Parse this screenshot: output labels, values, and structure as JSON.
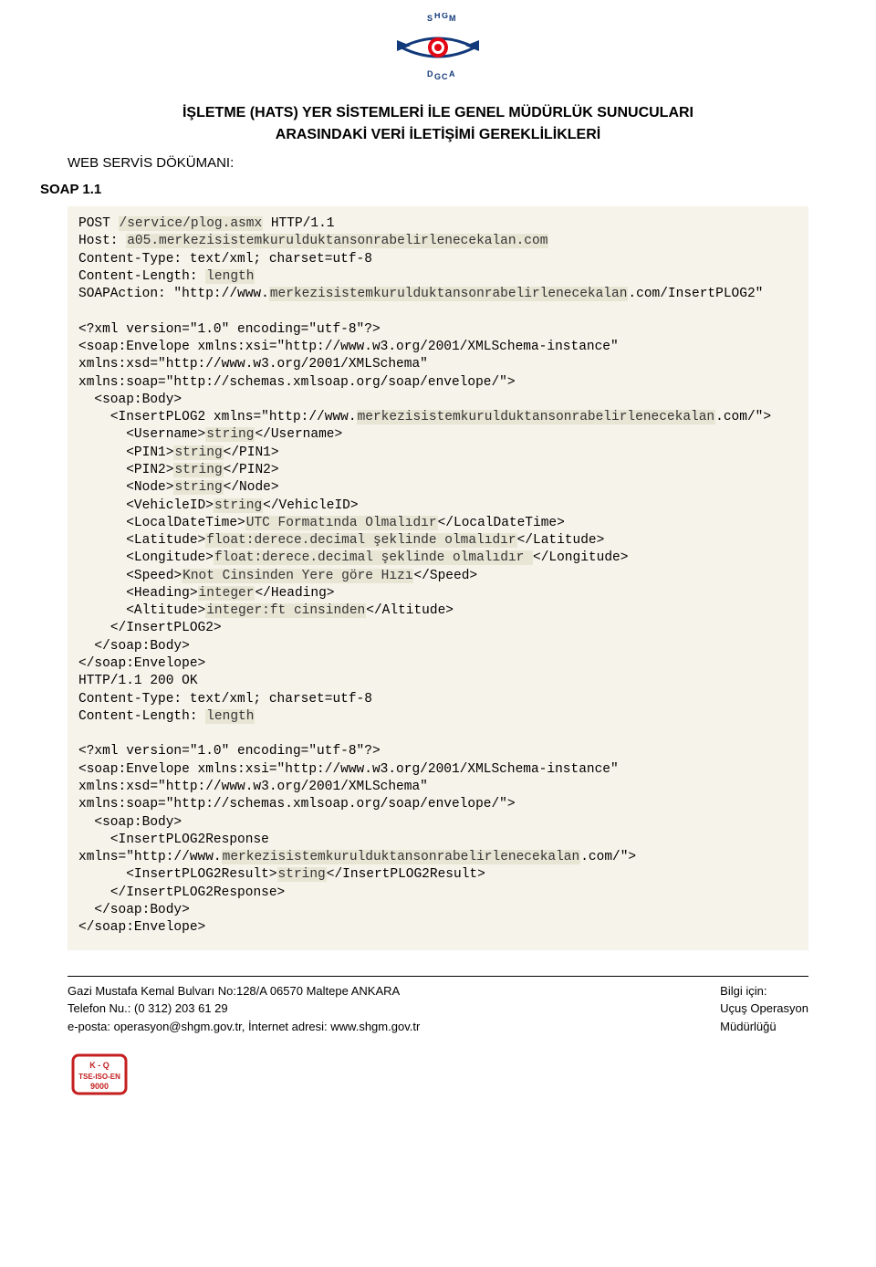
{
  "logo_text_top": "S H G M",
  "logo_text_bottom": "D G C A",
  "title_line1": "İŞLETME (HATS) YER SİSTEMLERİ İLE GENEL MÜDÜRLÜK SUNUCULARI",
  "title_line2": "ARASINDAKİ VERİ İLETİŞİMİ GEREKLİLİKLERİ",
  "subtitle": "WEB SERVİS DÖKÜMANI:",
  "soap_header": "SOAP 1.1",
  "code": {
    "l1a": "POST ",
    "l1b": "/service/plog.asmx",
    "l1c": " HTTP/1.1",
    "l2a": "Host: ",
    "l2b": "a05.merkezisistemkurulduktansonrabelirlenecekalan.com",
    "l3": "Content-Type: text/xml; charset=utf-8",
    "l4a": "Content-Length: ",
    "l4b": "length",
    "l5a": "SOAPAction: \"http://www.",
    "l5b": "merkezisistemkurulduktansonrabelirlenecekalan",
    "l5c": ".com/InsertPLOG2\"",
    "blank": "",
    "l7": "<?xml version=\"1.0\" encoding=\"utf-8\"?>",
    "l8": "<soap:Envelope xmlns:xsi=\"http://www.w3.org/2001/XMLSchema-instance\" xmlns:xsd=\"http://www.w3.org/2001/XMLSchema\" xmlns:soap=\"http://schemas.xmlsoap.org/soap/envelope/\">",
    "l11": "  <soap:Body>",
    "l12a": "    <InsertPLOG2 xmlns=\"http://www.",
    "l12b": "merkezisistemkurulduktansonrabelirlenecekalan",
    "l12c": ".com/\">",
    "l14a": "      <Username>",
    "l14b": "string",
    "l14c": "</Username>",
    "l15a": "      <PIN1>",
    "l15b": "string",
    "l15c": "</PIN1>",
    "l16a": "      <PIN2>",
    "l16b": "string",
    "l16c": "</PIN2>",
    "l17a": "      <Node>",
    "l17b": "string",
    "l17c": "</Node>",
    "l18a": "      <VehicleID>",
    "l18b": "string",
    "l18c": "</VehicleID>",
    "l19a": "      <LocalDateTime>",
    "l19b": "UTC Formatında Olmalıdır",
    "l19c": "</LocalDateTime>",
    "l20a": "      <Latitude>",
    "l20b": "float:derece.decimal şeklinde olmalıdır",
    "l20c": "</Latitude>",
    "l21a": "      <Longitude>",
    "l21b": "float:derece.decimal şeklinde olmalıdır ",
    "l21c": "</Longitude>",
    "l22a": "      <Speed>",
    "l22b": "Knot Cinsinden Yere göre Hızı",
    "l22c": "</Speed>",
    "l23a": "      <Heading>",
    "l23b": "integer",
    "l23c": "</Heading>",
    "l24a": "      <Altitude>",
    "l24b": "integer:ft cinsinden",
    "l24c": "</Altitude>",
    "l25": "    </InsertPLOG2>",
    "l26": "  </soap:Body>",
    "l27": "</soap:Envelope>",
    "l28": "HTTP/1.1 200 OK",
    "l29": "Content-Type: text/xml; charset=utf-8",
    "l30a": "Content-Length: ",
    "l30b": "length",
    "l32": "<?xml version=\"1.0\" encoding=\"utf-8\"?>",
    "l33": "<soap:Envelope xmlns:xsi=\"http://www.w3.org/2001/XMLSchema-instance\" xmlns:xsd=\"http://www.w3.org/2001/XMLSchema\" xmlns:soap=\"http://schemas.xmlsoap.org/soap/envelope/\">",
    "l36": "  <soap:Body>",
    "l37a": "    <InsertPLOG2Response xmlns=\"http://www.",
    "l37b": "merkezisistemkurulduktansonrabelirlenecekalan",
    "l37c": ".com/\">",
    "l39a": "      <InsertPLOG2Result>",
    "l39b": "string",
    "l39c": "</InsertPLOG2Result>",
    "l40": "    </InsertPLOG2Response>",
    "l41": "  </soap:Body>",
    "l42": "</soap:Envelope>"
  },
  "footer_left": {
    "addr": "Gazi Mustafa Kemal Bulvarı No:128/A 06570 Maltepe ANKARA",
    "tel": "Telefon Nu.: (0 312) 203 61 29",
    "mail": "e-posta: operasyon@shgm.gov.tr,  İnternet adresi: www.shgm.gov.tr"
  },
  "footer_right": {
    "l1": "Bilgi için:",
    "l2": "Uçuş Operasyon",
    "l3": "Müdürlüğü"
  },
  "cert_line1": "K - Q",
  "cert_line2": "TSE-ISO-EN",
  "cert_line3": "9000"
}
